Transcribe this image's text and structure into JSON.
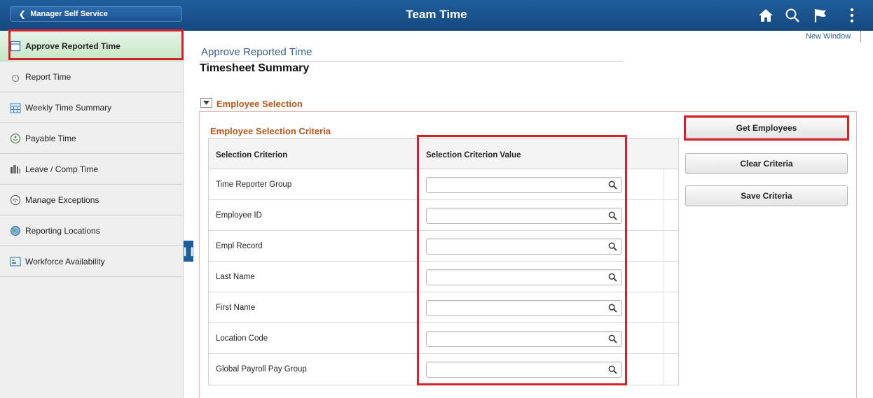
{
  "header": {
    "back_label": "Manager Self Service",
    "title": "Team Time",
    "icons": [
      "home-icon",
      "search-icon",
      "flag-icon",
      "more-menu-icon"
    ]
  },
  "sidebar": {
    "items": [
      {
        "label": "Approve Reported Time",
        "icon": "timesheet-icon",
        "active": true
      },
      {
        "label": "Report Time",
        "icon": "clock-icon"
      },
      {
        "label": "Weekly Time Summary",
        "icon": "calendar-icon"
      },
      {
        "label": "Payable Time",
        "icon": "payable-icon"
      },
      {
        "label": "Leave / Comp Time",
        "icon": "leave-icon"
      },
      {
        "label": "Manage Exceptions",
        "icon": "exceptions-icon"
      },
      {
        "label": "Reporting Locations",
        "icon": "locations-icon"
      },
      {
        "label": "Workforce Availability",
        "icon": "availability-icon"
      }
    ]
  },
  "main": {
    "new_window": "New Window",
    "subtitle": "Approve Reported Time",
    "title": "Timesheet Summary",
    "section_title": "Employee Selection",
    "grid_title": "Employee Selection Criteria",
    "columns": [
      "Selection Criterion",
      "Selection Criterion Value"
    ],
    "rows": [
      {
        "label": "Time Reporter Group",
        "value": ""
      },
      {
        "label": "Employee ID",
        "value": ""
      },
      {
        "label": "Empl Record",
        "value": ""
      },
      {
        "label": "Last Name",
        "value": ""
      },
      {
        "label": "First Name",
        "value": ""
      },
      {
        "label": "Location Code",
        "value": ""
      },
      {
        "label": "Global Payroll Pay Group",
        "value": ""
      }
    ],
    "buttons": {
      "get_employees": "Get Employees",
      "clear_criteria": "Clear Criteria",
      "save_criteria": "Save Criteria"
    }
  },
  "colors": {
    "header": "#1f5d9c",
    "section_title": "#b5561c",
    "highlight": "#d6202a",
    "active_nav": "#c6e8c6"
  }
}
